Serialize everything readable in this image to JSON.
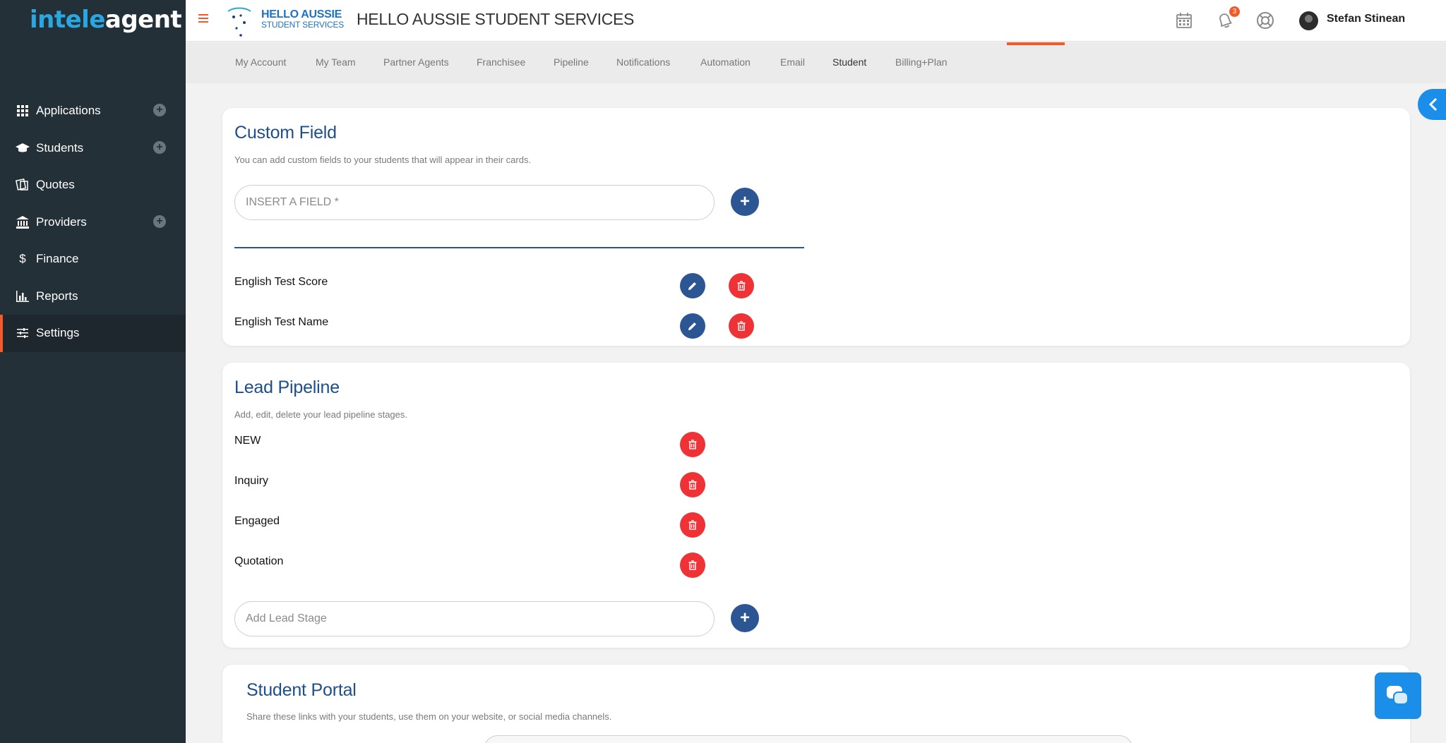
{
  "app": {
    "logo_part1": "intele",
    "logo_part2": "agent"
  },
  "sidebar": {
    "items": [
      {
        "label": "Applications",
        "icon": "grid-icon",
        "has_add": true
      },
      {
        "label": "Students",
        "icon": "graduation-cap-icon",
        "has_add": true
      },
      {
        "label": "Quotes",
        "icon": "quotes-icon",
        "has_add": false
      },
      {
        "label": "Providers",
        "icon": "bank-icon",
        "has_add": true
      },
      {
        "label": "Finance",
        "icon": "dollar-icon",
        "has_add": false
      },
      {
        "label": "Reports",
        "icon": "bar-chart-icon",
        "has_add": false
      },
      {
        "label": "Settings",
        "icon": "sliders-icon",
        "has_add": false,
        "active": true
      }
    ]
  },
  "header": {
    "brand_line1": "HELLO AUSSIE",
    "brand_line2": "STUDENT SERVICES",
    "company_name": "HELLO AUSSIE STUDENT SERVICES",
    "notification_count": "3",
    "user_name": "Stefan Stinean"
  },
  "tabs": [
    {
      "label": "My Account"
    },
    {
      "label": "My Team"
    },
    {
      "label": "Partner Agents"
    },
    {
      "label": "Franchisee"
    },
    {
      "label": "Pipeline"
    },
    {
      "label": "Notifications"
    },
    {
      "label": "Automation"
    },
    {
      "label": "Email"
    },
    {
      "label": "Student",
      "active": true
    },
    {
      "label": "Billing+Plan"
    }
  ],
  "custom_field": {
    "title": "Custom Field",
    "description": "You can add custom fields to your students that will appear in their cards.",
    "input_placeholder": "INSERT A FIELD *",
    "fields": [
      "English Test Score",
      "English Test Name"
    ]
  },
  "lead_pipeline": {
    "title": "Lead Pipeline",
    "description": "Add, edit, delete your lead pipeline stages.",
    "stages": [
      "NEW",
      "Inquiry",
      "Engaged",
      "Quotation"
    ],
    "input_placeholder": "Add Lead Stage"
  },
  "student_portal": {
    "title": "Student Portal",
    "description": "Share these links with your students, use them on your website, or social media channels."
  },
  "colors": {
    "accent": "#f25a29",
    "primary": "#2c5593",
    "danger": "#ee3236",
    "sidebar": "#243038"
  }
}
